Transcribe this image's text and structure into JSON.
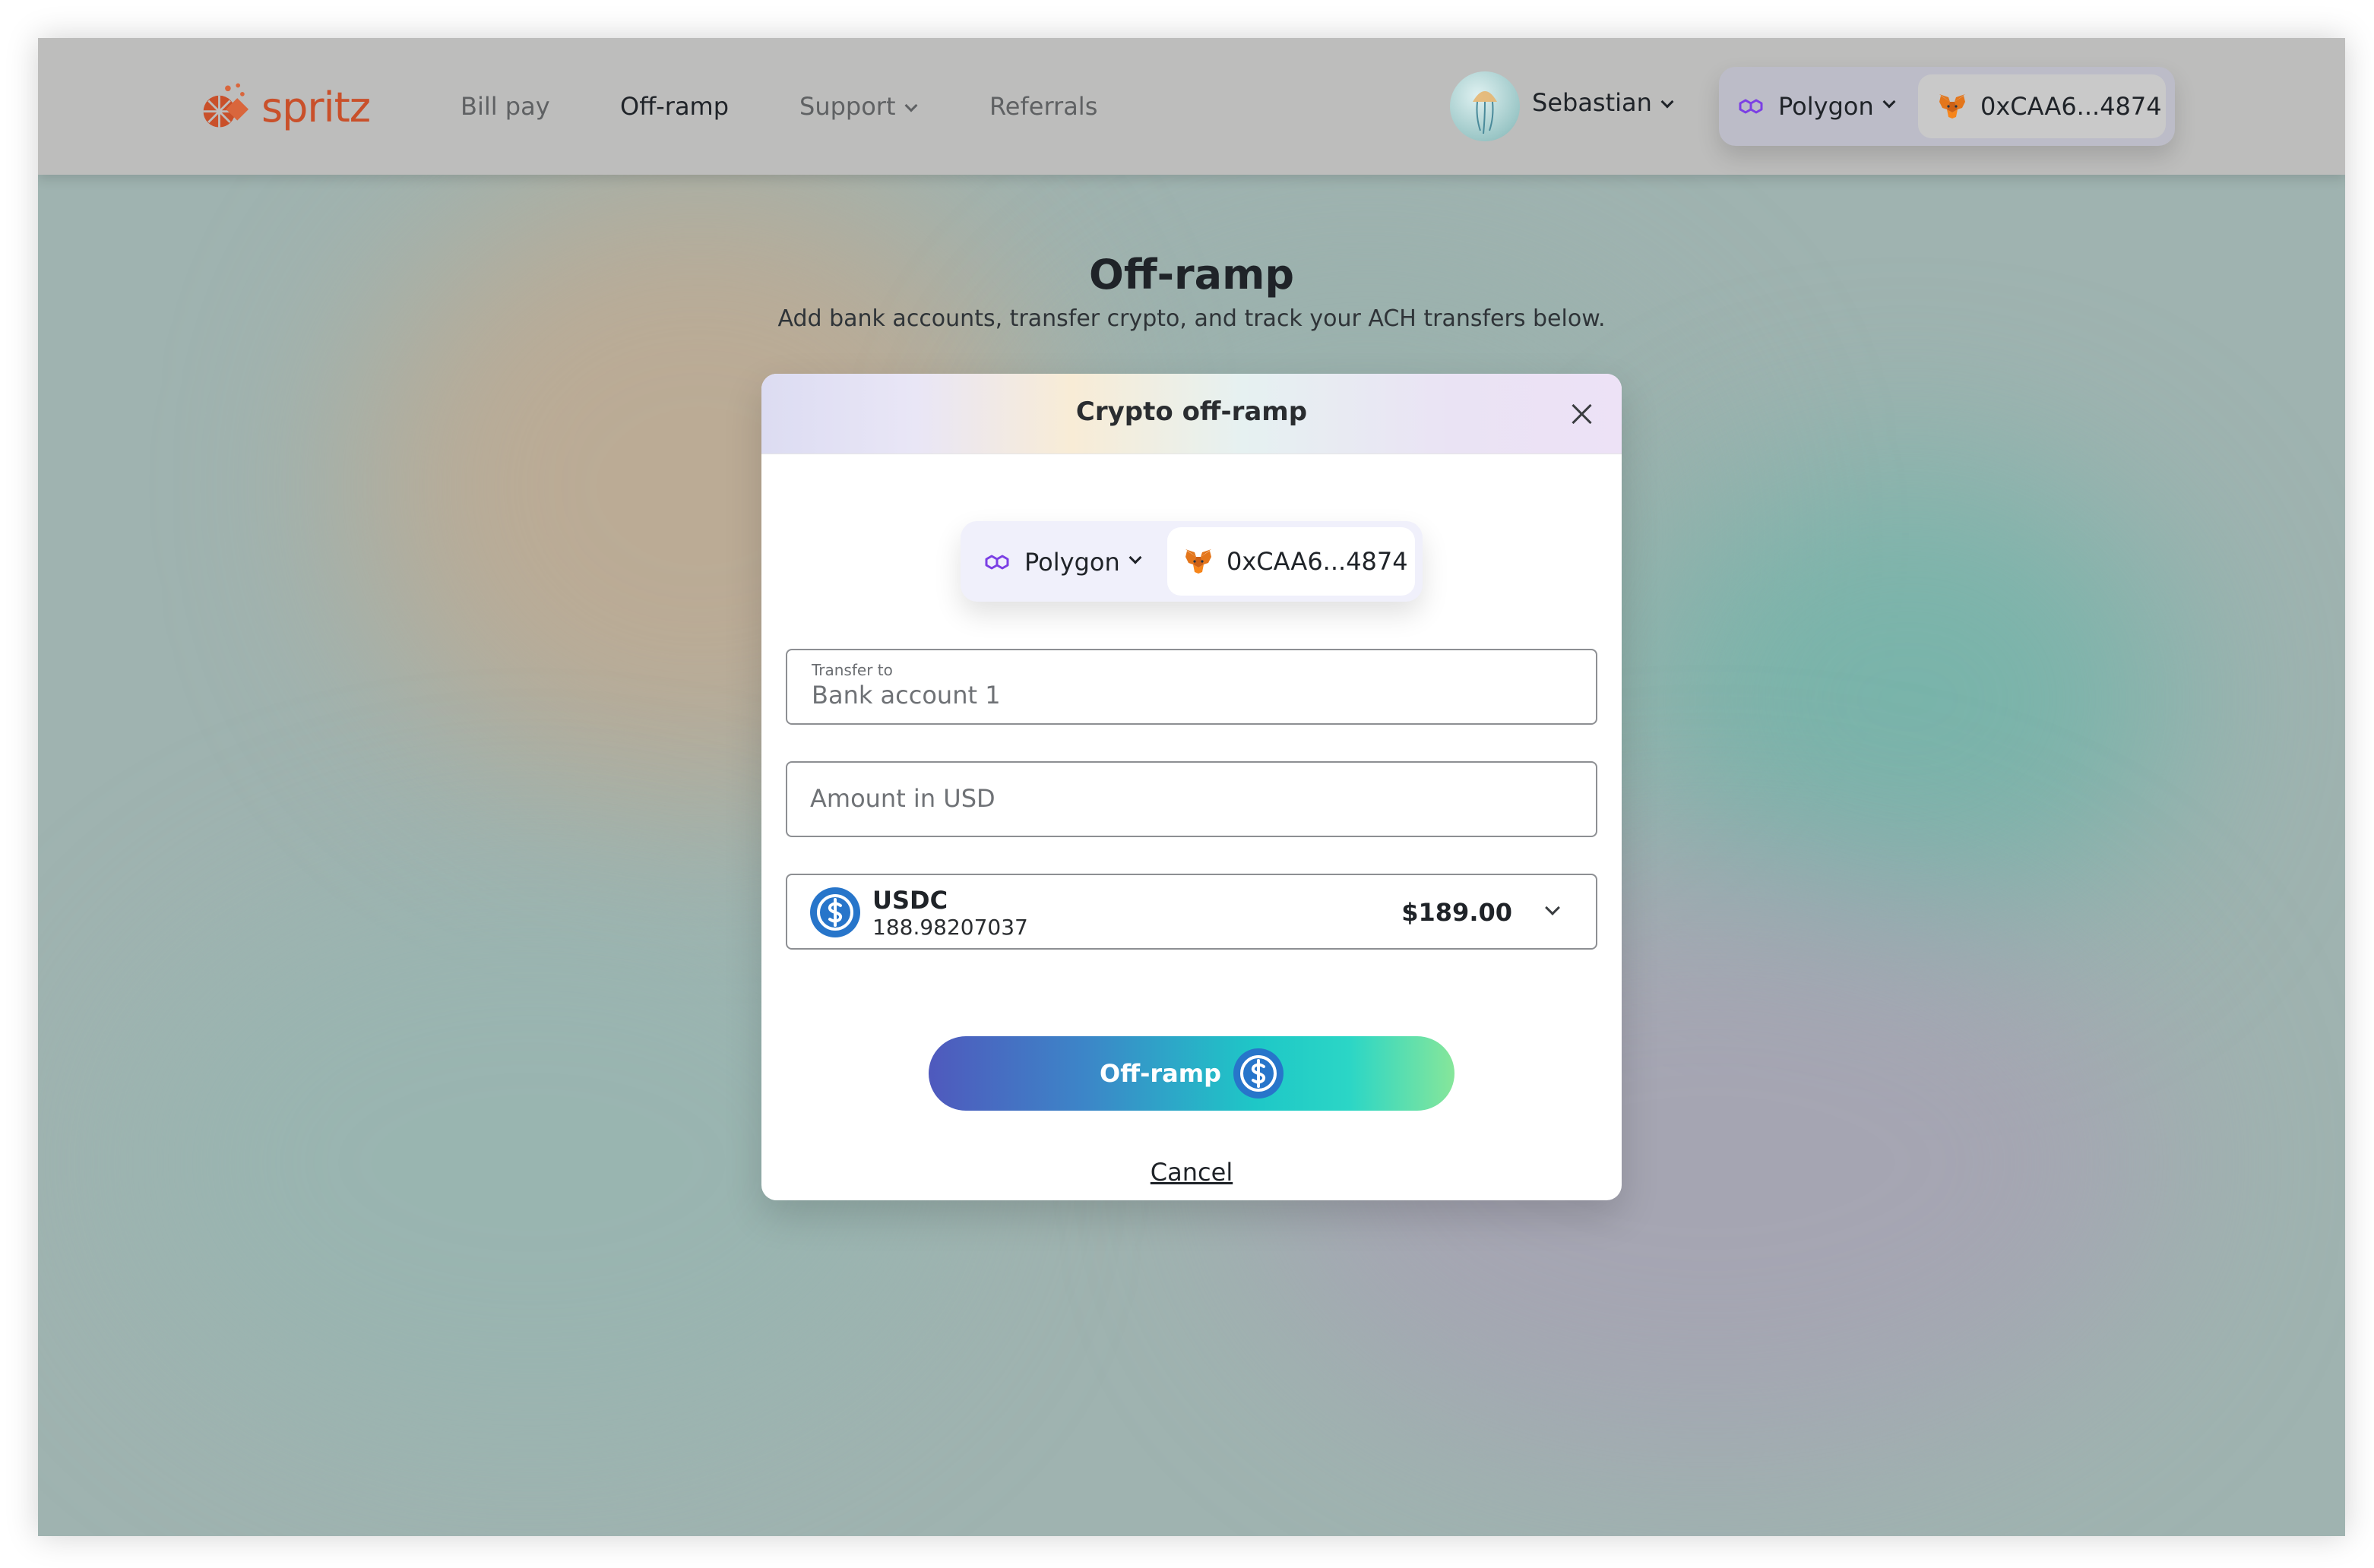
{
  "header": {
    "logo_text": "spritz",
    "nav": [
      {
        "label": "Bill pay"
      },
      {
        "label": "Off-ramp"
      },
      {
        "label": "Support"
      },
      {
        "label": "Referrals"
      }
    ],
    "user_name": "Sebastian",
    "network": "Polygon",
    "wallet_address": "0xCAA6...4874"
  },
  "page": {
    "title": "Off-ramp",
    "subtitle": "Add bank accounts, transfer crypto, and track your ACH transfers below."
  },
  "modal": {
    "title": "Crypto off-ramp",
    "network": "Polygon",
    "wallet_address": "0xCAA6...4874",
    "transfer_to_label": "Transfer to",
    "transfer_to_value": "Bank account 1",
    "amount_placeholder": "Amount in USD",
    "token": {
      "symbol": "USDC",
      "balance": "188.98207037",
      "usd_value": "$189.00"
    },
    "submit_label": "Off-ramp",
    "cancel_label": "Cancel"
  },
  "colors": {
    "brand": "#c9502a",
    "polygon": "#7b3fe4",
    "usdc": "#2775ca",
    "button_gradient_start": "#4f59bd",
    "button_gradient_end": "#86e69a"
  },
  "icons": {
    "logo": "spritz-logo-icon",
    "network": "polygon-icon",
    "wallet": "metamask-fox-icon",
    "token": "usdc-icon",
    "close": "close-icon"
  }
}
